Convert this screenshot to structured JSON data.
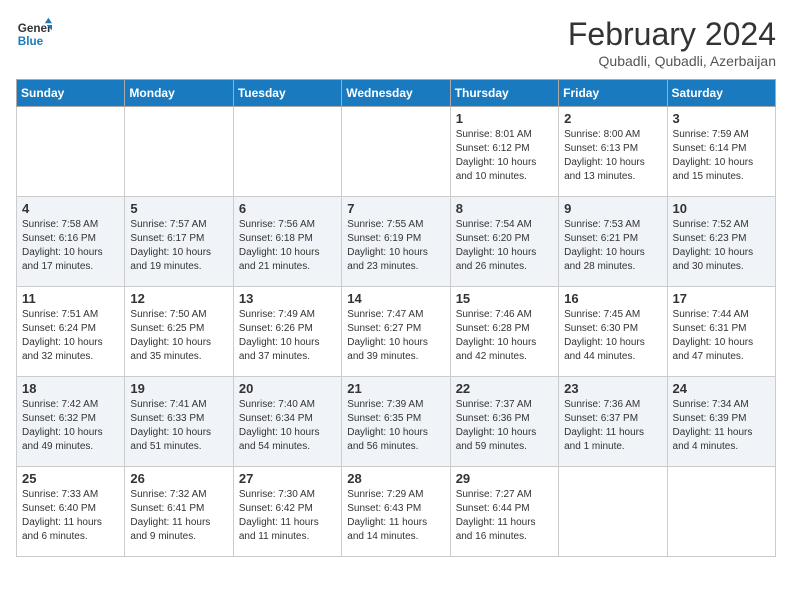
{
  "header": {
    "logo_general": "General",
    "logo_blue": "Blue",
    "title": "February 2024",
    "subtitle": "Qubadli, Qubadli, Azerbaijan"
  },
  "days_of_week": [
    "Sunday",
    "Monday",
    "Tuesday",
    "Wednesday",
    "Thursday",
    "Friday",
    "Saturday"
  ],
  "weeks": [
    [
      {
        "day": "",
        "info": ""
      },
      {
        "day": "",
        "info": ""
      },
      {
        "day": "",
        "info": ""
      },
      {
        "day": "",
        "info": ""
      },
      {
        "day": "1",
        "info": "Sunrise: 8:01 AM\nSunset: 6:12 PM\nDaylight: 10 hours\nand 10 minutes."
      },
      {
        "day": "2",
        "info": "Sunrise: 8:00 AM\nSunset: 6:13 PM\nDaylight: 10 hours\nand 13 minutes."
      },
      {
        "day": "3",
        "info": "Sunrise: 7:59 AM\nSunset: 6:14 PM\nDaylight: 10 hours\nand 15 minutes."
      }
    ],
    [
      {
        "day": "4",
        "info": "Sunrise: 7:58 AM\nSunset: 6:16 PM\nDaylight: 10 hours\nand 17 minutes."
      },
      {
        "day": "5",
        "info": "Sunrise: 7:57 AM\nSunset: 6:17 PM\nDaylight: 10 hours\nand 19 minutes."
      },
      {
        "day": "6",
        "info": "Sunrise: 7:56 AM\nSunset: 6:18 PM\nDaylight: 10 hours\nand 21 minutes."
      },
      {
        "day": "7",
        "info": "Sunrise: 7:55 AM\nSunset: 6:19 PM\nDaylight: 10 hours\nand 23 minutes."
      },
      {
        "day": "8",
        "info": "Sunrise: 7:54 AM\nSunset: 6:20 PM\nDaylight: 10 hours\nand 26 minutes."
      },
      {
        "day": "9",
        "info": "Sunrise: 7:53 AM\nSunset: 6:21 PM\nDaylight: 10 hours\nand 28 minutes."
      },
      {
        "day": "10",
        "info": "Sunrise: 7:52 AM\nSunset: 6:23 PM\nDaylight: 10 hours\nand 30 minutes."
      }
    ],
    [
      {
        "day": "11",
        "info": "Sunrise: 7:51 AM\nSunset: 6:24 PM\nDaylight: 10 hours\nand 32 minutes."
      },
      {
        "day": "12",
        "info": "Sunrise: 7:50 AM\nSunset: 6:25 PM\nDaylight: 10 hours\nand 35 minutes."
      },
      {
        "day": "13",
        "info": "Sunrise: 7:49 AM\nSunset: 6:26 PM\nDaylight: 10 hours\nand 37 minutes."
      },
      {
        "day": "14",
        "info": "Sunrise: 7:47 AM\nSunset: 6:27 PM\nDaylight: 10 hours\nand 39 minutes."
      },
      {
        "day": "15",
        "info": "Sunrise: 7:46 AM\nSunset: 6:28 PM\nDaylight: 10 hours\nand 42 minutes."
      },
      {
        "day": "16",
        "info": "Sunrise: 7:45 AM\nSunset: 6:30 PM\nDaylight: 10 hours\nand 44 minutes."
      },
      {
        "day": "17",
        "info": "Sunrise: 7:44 AM\nSunset: 6:31 PM\nDaylight: 10 hours\nand 47 minutes."
      }
    ],
    [
      {
        "day": "18",
        "info": "Sunrise: 7:42 AM\nSunset: 6:32 PM\nDaylight: 10 hours\nand 49 minutes."
      },
      {
        "day": "19",
        "info": "Sunrise: 7:41 AM\nSunset: 6:33 PM\nDaylight: 10 hours\nand 51 minutes."
      },
      {
        "day": "20",
        "info": "Sunrise: 7:40 AM\nSunset: 6:34 PM\nDaylight: 10 hours\nand 54 minutes."
      },
      {
        "day": "21",
        "info": "Sunrise: 7:39 AM\nSunset: 6:35 PM\nDaylight: 10 hours\nand 56 minutes."
      },
      {
        "day": "22",
        "info": "Sunrise: 7:37 AM\nSunset: 6:36 PM\nDaylight: 10 hours\nand 59 minutes."
      },
      {
        "day": "23",
        "info": "Sunrise: 7:36 AM\nSunset: 6:37 PM\nDaylight: 11 hours\nand 1 minute."
      },
      {
        "day": "24",
        "info": "Sunrise: 7:34 AM\nSunset: 6:39 PM\nDaylight: 11 hours\nand 4 minutes."
      }
    ],
    [
      {
        "day": "25",
        "info": "Sunrise: 7:33 AM\nSunset: 6:40 PM\nDaylight: 11 hours\nand 6 minutes."
      },
      {
        "day": "26",
        "info": "Sunrise: 7:32 AM\nSunset: 6:41 PM\nDaylight: 11 hours\nand 9 minutes."
      },
      {
        "day": "27",
        "info": "Sunrise: 7:30 AM\nSunset: 6:42 PM\nDaylight: 11 hours\nand 11 minutes."
      },
      {
        "day": "28",
        "info": "Sunrise: 7:29 AM\nSunset: 6:43 PM\nDaylight: 11 hours\nand 14 minutes."
      },
      {
        "day": "29",
        "info": "Sunrise: 7:27 AM\nSunset: 6:44 PM\nDaylight: 11 hours\nand 16 minutes."
      },
      {
        "day": "",
        "info": ""
      },
      {
        "day": "",
        "info": ""
      }
    ]
  ]
}
